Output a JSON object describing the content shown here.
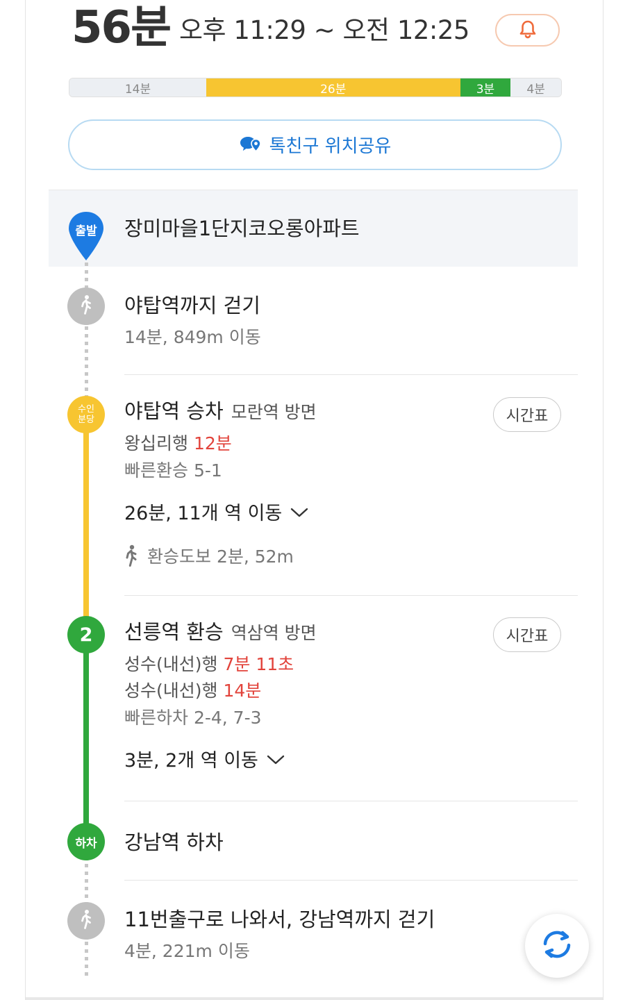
{
  "header": {
    "total_time": "56분",
    "time_range": "오후 11:29 ~ 오전 12:25"
  },
  "segments": [
    {
      "label": "14분",
      "minutes": 14,
      "color": "#eceff3",
      "text_color": "#888888"
    },
    {
      "label": "26분",
      "minutes": 26,
      "color": "#f7c531",
      "text_color": "#ffffff"
    },
    {
      "label": "3분",
      "minutes": 3,
      "color": "#30a83d",
      "text_color": "#ffffff"
    },
    {
      "label": "4분",
      "minutes": 4,
      "color": "#eceff3",
      "text_color": "#888888"
    }
  ],
  "share_button": {
    "label": "톡친구 위치공유"
  },
  "start": {
    "badge": "출발",
    "name": "장미마을1단지코오롱아파트"
  },
  "walk1": {
    "title": "야탑역까지 걷기",
    "detail": "14분, 849m 이동"
  },
  "leg1": {
    "badge_line1": "수인",
    "badge_line2": "분당",
    "station": "야탑역 승차",
    "direction": "모란역 방면",
    "timetable": "시간표",
    "arrival_dest": "왕십리행",
    "arrival_time": "12분",
    "fast_transfer": "빠른환승 5-1",
    "ride_summary": "26분, 11개 역 이동",
    "transfer_walk": "환승도보 2분, 52m"
  },
  "leg2": {
    "badge": "2",
    "station": "선릉역 환승",
    "direction": "역삼역 방면",
    "timetable": "시간표",
    "arrival1_dest": "성수(내선)행",
    "arrival1_time": "7분 11초",
    "arrival2_dest": "성수(내선)행",
    "arrival2_time": "14분",
    "fast_exit": "빠른하차 2-4, 7-3",
    "ride_summary": "3분, 2개 역 이동"
  },
  "alight": {
    "badge": "하차",
    "station": "강남역 하차"
  },
  "walk2": {
    "title": "11번출구로 나와서, 강남역까지 걷기",
    "detail": "4분, 221m 이동"
  },
  "colors": {
    "blue": "#1d7be2",
    "suin_bundang": "#f7c531",
    "line2": "#30a83d",
    "arrival_red": "#e2433b",
    "walk_gray": "#bfbfbf"
  }
}
